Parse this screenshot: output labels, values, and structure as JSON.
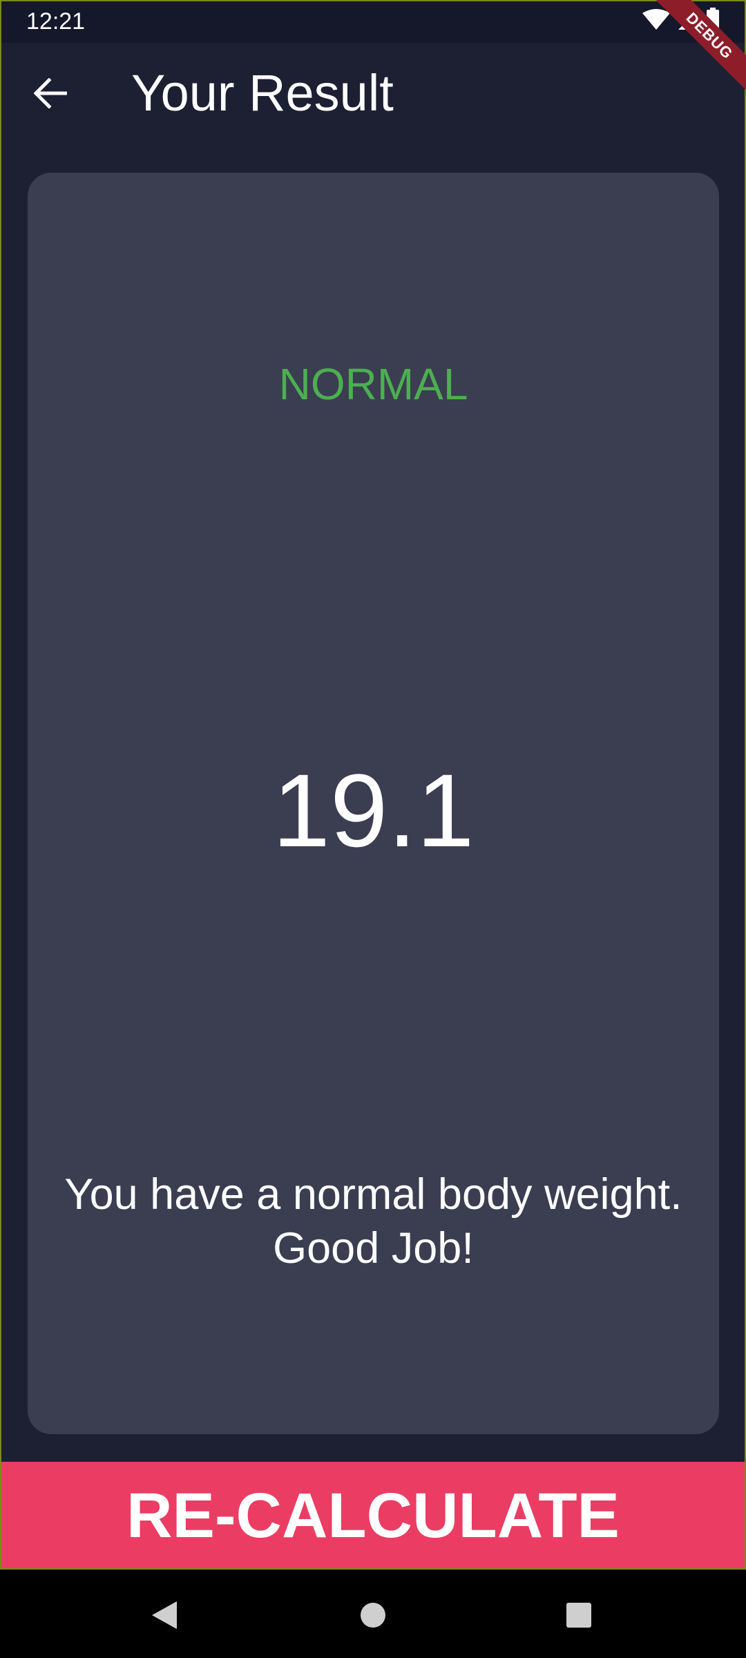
{
  "status_bar": {
    "time": "12:21",
    "icons": [
      "wifi-icon",
      "cellular-signal-icon",
      "battery-icon"
    ]
  },
  "debug_banner": {
    "label": "DEBUG"
  },
  "app_bar": {
    "back_icon": "arrow-back-icon",
    "title": "Your Result"
  },
  "result": {
    "status": "NORMAL",
    "value": "19.1",
    "message": "You have a normal body weight. Good Job!"
  },
  "recalculate_button": {
    "label": "RE-CALCULATE"
  },
  "nav_bar": {
    "buttons": [
      "back-triangle-icon",
      "home-circle-icon",
      "recents-square-icon"
    ]
  },
  "colors": {
    "background": "#1d1f33",
    "card": "#3b3d51",
    "status_normal": "#4caf50",
    "accent": "#eb3d64",
    "debug_banner": "#8e1d2a"
  }
}
